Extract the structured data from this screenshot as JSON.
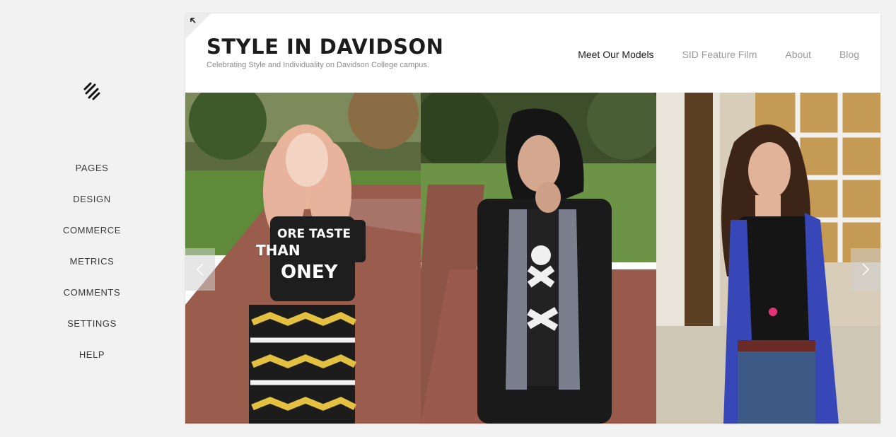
{
  "sidebar": {
    "items": [
      {
        "label": "PAGES"
      },
      {
        "label": "DESIGN"
      },
      {
        "label": "COMMERCE"
      },
      {
        "label": "METRICS"
      },
      {
        "label": "COMMENTS"
      },
      {
        "label": "SETTINGS"
      },
      {
        "label": "HELP"
      }
    ]
  },
  "site": {
    "title": "STYLE IN DAVIDSON",
    "tagline": "Celebrating Style and Individuality on Davidson College campus.",
    "nav": [
      {
        "label": "Meet Our Models",
        "active": true
      },
      {
        "label": "SID Feature Film",
        "active": false
      },
      {
        "label": "About",
        "active": false
      },
      {
        "label": "Blog",
        "active": false
      }
    ]
  },
  "gallery": {
    "slides": [
      {
        "shirt_text_1": "ORE TASTE",
        "shirt_text_2": "THAN",
        "shirt_text_3": "ONEY"
      },
      {},
      {}
    ]
  },
  "icons": {
    "logo": "squarespace-logo-icon",
    "collapse": "collapse-arrow-icon",
    "prev": "chevron-left-icon",
    "next": "chevron-right-icon"
  }
}
